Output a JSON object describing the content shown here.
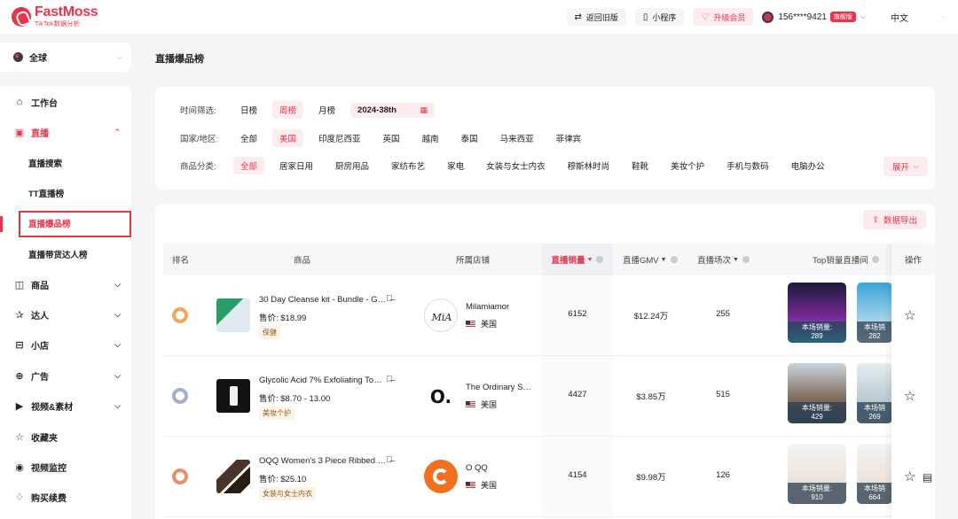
{
  "brand": {
    "name": "FastMoss",
    "subtitle": "TikTok数据分析"
  },
  "topbar": {
    "back_label": "返回旧版",
    "miniapp_label": "小程序",
    "upgrade_label": "升级会员",
    "user_phone": "156****9421",
    "user_badge": "旗舰版",
    "language": "中文"
  },
  "region": {
    "label": "全球"
  },
  "sidebar": {
    "workbench": "工作台",
    "live": "直播",
    "live_search": "直播搜索",
    "tt_live_rank": "TT直播榜",
    "live_product_rank": "直播爆品榜",
    "live_influencer_rank": "直播带货达人榜",
    "products": "商品",
    "influencers": "达人",
    "shops": "小店",
    "ads": "广告",
    "video_material": "视频&素材",
    "favorites": "收藏夹",
    "video_monitor": "视频监控",
    "purchase": "购买续费"
  },
  "page": {
    "title": "直播爆品榜"
  },
  "filters": {
    "time_label": "时间筛选:",
    "time_options": [
      "日榜",
      "周榜",
      "月榜"
    ],
    "time_selected": "周榜",
    "date_value": "2024-38th",
    "region_label": "国家/地区:",
    "region_options": [
      "全部",
      "美国",
      "印度尼西亚",
      "英国",
      "越南",
      "泰国",
      "马来西亚",
      "菲律宾"
    ],
    "region_selected": "美国",
    "category_label": "商品分类:",
    "category_options": [
      "全部",
      "居家日用",
      "厨房用品",
      "家纺布艺",
      "家电",
      "女装与女士内衣",
      "穆斯林时尚",
      "鞋靴",
      "美妆个护",
      "手机与数码",
      "电脑办公"
    ],
    "category_selected": "全部",
    "expand_label": "展开"
  },
  "table": {
    "export_label": "数据导出",
    "headers": {
      "rank": "排名",
      "product": "商品",
      "shop": "所属店铺",
      "sales": "直播销量",
      "gmv": "直播GMV",
      "sessions": "直播场次",
      "top_lives": "Top销量直播间",
      "ops": "操作"
    },
    "rows": [
      {
        "name": "30 Day Cleanse kit - Bundle - G…",
        "price": "售价: $18.99",
        "tag": "保健",
        "shop": "Milamiamor",
        "country": "美国",
        "sales": "6152",
        "gmv": "$12.24万",
        "sessions": "255",
        "live1": "本场销量:\n289",
        "live2": "本场销\n282"
      },
      {
        "name": "Glycolic Acid 7% Exfoliating To…",
        "price": "售价: $8.70 - 13.00",
        "tag": "美妆个护",
        "shop": "The Ordinary S…",
        "country": "美国",
        "sales": "4427",
        "gmv": "$3.85万",
        "sessions": "515",
        "live1": "本场销量:\n429",
        "live2": "本场销\n269"
      },
      {
        "name": "OQQ Women's 3 Piece Ribbed …",
        "price": "售价: $25.10",
        "tag": "女装与女士内衣",
        "shop": "O QQ",
        "country": "美国",
        "sales": "4154",
        "gmv": "$9.98万",
        "sessions": "126",
        "live1": "本场销量:\n910",
        "live2": "本场销\n664"
      }
    ]
  },
  "colors": {
    "accent": "#e8354d",
    "accent_soft": "#fdecee"
  }
}
